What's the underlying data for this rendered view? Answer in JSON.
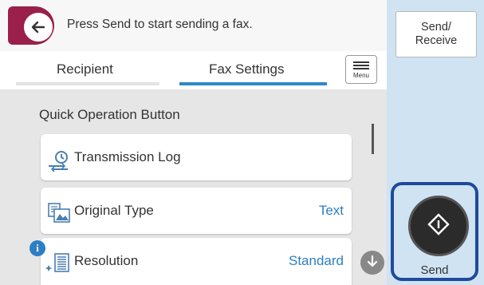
{
  "header": {
    "back_icon": "arrow-left-icon",
    "message": "Press Send to start sending a fax."
  },
  "tabs": [
    {
      "label": "Recipient",
      "selected": false
    },
    {
      "label": "Fax Settings",
      "selected": true
    }
  ],
  "menu_button": {
    "label": "Menu",
    "icon": "hamburger-icon"
  },
  "section_title": "Quick Operation Button",
  "items": [
    {
      "label": "Transmission Log",
      "value": "",
      "icon": "transmission-log-icon"
    },
    {
      "label": "Original Type",
      "value": "Text",
      "icon": "original-type-icon"
    },
    {
      "label": "Resolution",
      "value": "Standard",
      "icon": "resolution-icon"
    }
  ],
  "right_panel": {
    "send_receive_line1": "Send/",
    "send_receive_line2": "Receive",
    "send_label": "Send",
    "send_icon": "diamond-start-icon"
  },
  "colors": {
    "accent_blue": "#2d8ac7",
    "back_button": "#9a1f4b",
    "highlight_frame": "#1f4a9b",
    "right_panel_bg": "#cfe3f3"
  }
}
